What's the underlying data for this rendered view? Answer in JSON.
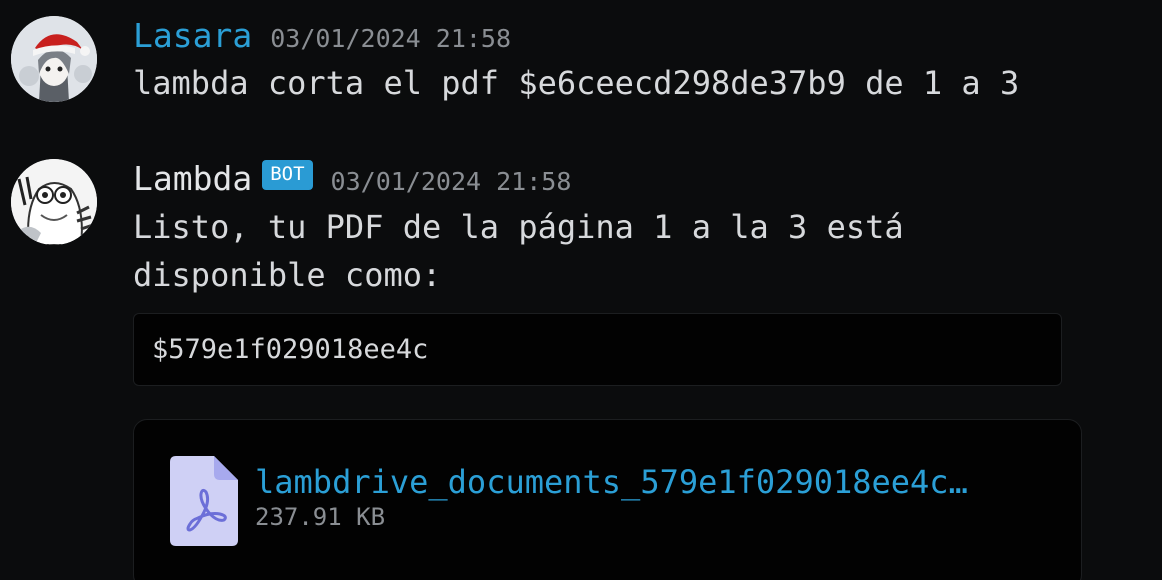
{
  "messages": [
    {
      "username": "Lasara",
      "timestamp": "03/01/2024 21:58",
      "text": "lambda corta el pdf $e6ceecd298de37b9 de 1 a 3",
      "avatar_icon": "user-avatar-santa-hat"
    },
    {
      "username": "Lambda",
      "badge": "BOT",
      "timestamp": "03/01/2024 21:58",
      "text": "Listo, tu PDF de la página 1 a la 3 está\ndisponible como:",
      "avatar_icon": "bot-avatar-hamster",
      "code": "$579e1f029018ee4c",
      "attachment": {
        "file_name": "lambdrive_documents_579e1f029018ee4c…",
        "file_size": "237.91 KB",
        "icon": "pdf-file-icon"
      }
    }
  ],
  "colors": {
    "background": "#0b0c0d",
    "user_name": "#2b9fd6",
    "link": "#2b9fd6",
    "bot_badge": "#2a9bd4",
    "timestamp": "#8a8e93",
    "file_icon": "#cfd0f5",
    "pdf_glyph": "#6c6fd8"
  }
}
